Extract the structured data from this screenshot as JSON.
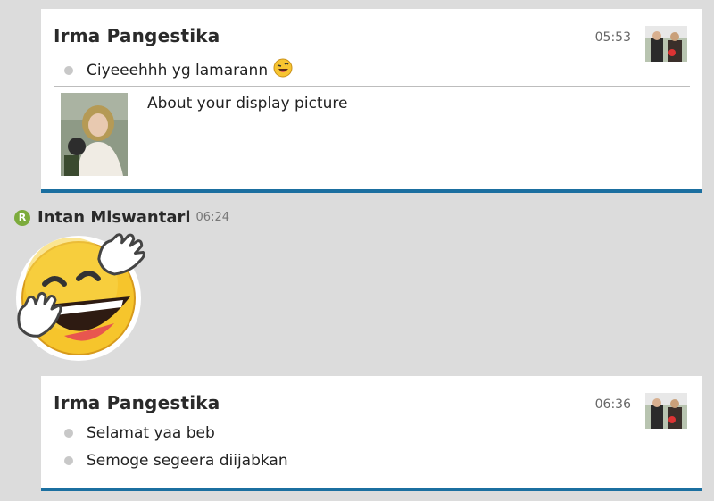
{
  "messages": [
    {
      "sender": "Irma Pangestika",
      "time": "05:53",
      "lines": [
        "Ciyeeehhh yg lamarann"
      ],
      "reply": {
        "text": "About your display picture"
      }
    },
    {
      "sender": "Intan Miswantari",
      "time": "06:24",
      "badge": "R"
    },
    {
      "sender": "Irma Pangestika",
      "time": "06:36",
      "lines": [
        "Selamat yaa beb",
        "Semoge segeera diijabkan"
      ]
    }
  ],
  "colors": {
    "accent": "#1b6fa0",
    "badge": "#7cab3c",
    "background": "#dcdcdc"
  },
  "icons": {
    "inline_emoji": "laughing-wink-emoji-icon",
    "sticker": "waving-laughing-face-sticker"
  }
}
